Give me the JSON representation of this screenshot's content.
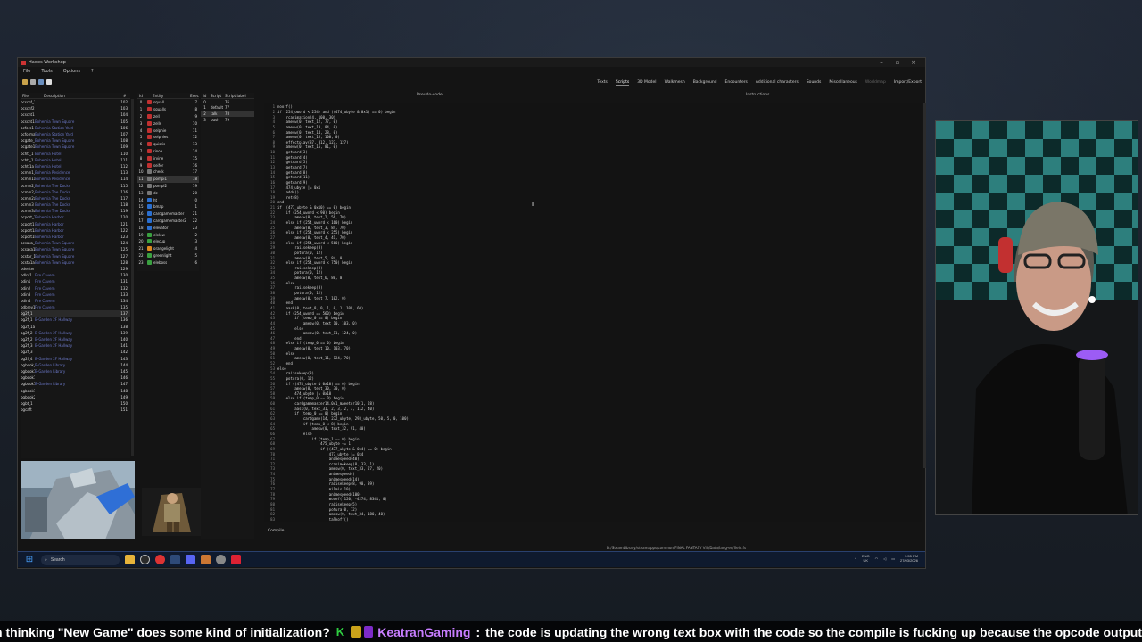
{
  "app": {
    "title": "Hades Workshop",
    "menu": [
      "File",
      "Tools",
      "Options",
      "?"
    ],
    "top_tabs": [
      "Texts",
      "Scripts",
      "3D Model",
      "Walkmesh",
      "Background",
      "Encounters",
      "Additional characters",
      "Sounds",
      "Miscellaneous",
      "Worldmap",
      "Import/Export"
    ],
    "active_tab": "Scripts",
    "file_panel": {
      "headers": [
        "File",
        "Description",
        "#"
      ],
      "rows": [
        {
          "f": "bcscnf_1",
          "d": "",
          "n": "102"
        },
        {
          "f": "bcscnf2",
          "d": "",
          "n": "103"
        },
        {
          "f": "bcscnt15",
          "d": "",
          "n": "104"
        },
        {
          "f": "bcscnt1a",
          "d": "Bohemia Town Square",
          "n": "105"
        },
        {
          "f": "bcfors1",
          "d": "Bohemia Station Yard",
          "n": "106"
        },
        {
          "f": "bcforma1a",
          "d": "Bohemia Station Yard",
          "n": "107"
        },
        {
          "f": "bcgate_1",
          "d": "Bohemia Town Square",
          "n": "108"
        },
        {
          "f": "bcgate1a",
          "d": "Bohemia Town Square",
          "n": "109"
        },
        {
          "f": "bchtl_1",
          "d": "Bohemia Hotel",
          "n": "110"
        },
        {
          "f": "bchtl_1",
          "d": "Bohemia Hotel",
          "n": "111"
        },
        {
          "f": "bchtl1a",
          "d": "Bohemia Hotel",
          "n": "112"
        },
        {
          "f": "bcmin1_1",
          "d": "Bohemia Residence",
          "n": "113"
        },
        {
          "f": "bcmin1a",
          "d": "Bohemia Residence",
          "n": "114"
        },
        {
          "f": "bcmin2_1",
          "d": "Bohemia The Docks",
          "n": "115"
        },
        {
          "f": "bcmin2_1",
          "d": "Bohemia The Docks",
          "n": "116"
        },
        {
          "f": "bcmin2a",
          "d": "Bohemia The Docks",
          "n": "117"
        },
        {
          "f": "bcmin3",
          "d": "Bohemia The Docks",
          "n": "118"
        },
        {
          "f": "bcmin3a",
          "d": "Bohemia The Docks",
          "n": "119"
        },
        {
          "f": "bcport_1",
          "d": "Bohemia Harbor",
          "n": "120"
        },
        {
          "f": "bcport1",
          "d": "Bohemia Harbor",
          "n": "121"
        },
        {
          "f": "bcport1a",
          "d": "Bohemia Harbor",
          "n": "122"
        },
        {
          "f": "bcport1b",
          "d": "Bohemia Harbor",
          "n": "123"
        },
        {
          "f": "bcsaka_1",
          "d": "Bohemia Town Square",
          "n": "124"
        },
        {
          "f": "bcsaka1a",
          "d": "Bohemia Town Square",
          "n": "125"
        },
        {
          "f": "bcstar_1",
          "d": "Bohemia Town Square",
          "n": "127"
        },
        {
          "f": "bcsta1a",
          "d": "Bohemia Town Square",
          "n": "128"
        },
        {
          "f": "bdenter1",
          "d": "",
          "n": "129"
        },
        {
          "f": "bdlnt1",
          "d": "Fire Cavern",
          "n": "130"
        },
        {
          "f": "bdin1",
          "d": "Fire Cavern",
          "n": "131"
        },
        {
          "f": "bdin2",
          "d": "Fire Cavern",
          "n": "132"
        },
        {
          "f": "bdin3",
          "d": "Fire Cavern",
          "n": "133"
        },
        {
          "f": "bdin4",
          "d": "Fire Cavern",
          "n": "134"
        },
        {
          "f": "bdbrev1",
          "d": "Fire Cavern",
          "n": "135"
        },
        {
          "f": "bg2f_1",
          "d": "",
          "n": "137"
        },
        {
          "f": "bg2f_1",
          "d": "B-Garden 2F Hallway",
          "n": "136"
        },
        {
          "f": "bg2f_1a",
          "d": "",
          "n": "138"
        },
        {
          "f": "bg2f_2",
          "d": "B-Garden 2F Hallway",
          "n": "139"
        },
        {
          "f": "bg2f_2",
          "d": "B-Garden 2F Hallway",
          "n": "140"
        },
        {
          "f": "bg2f_3",
          "d": "B-Garden 2F Hallway",
          "n": "141"
        },
        {
          "f": "bg2f_3",
          "d": "",
          "n": "142"
        },
        {
          "f": "bg2f_4",
          "d": "B-Garden 2F Hallway",
          "n": "143"
        },
        {
          "f": "bgbook_1",
          "d": "B-Garden Library",
          "n": "144"
        },
        {
          "f": "bgbook1",
          "d": "B-Garden Library",
          "n": "145"
        },
        {
          "f": "bgbook1a",
          "d": "",
          "n": "146"
        },
        {
          "f": "bgbook1b",
          "d": "B-Garden Library",
          "n": "147"
        },
        {
          "f": "bgbook1c",
          "d": "",
          "n": "148"
        },
        {
          "f": "bgbook2",
          "d": "",
          "n": "149"
        },
        {
          "f": "bgbt_1",
          "d": "",
          "n": "150"
        },
        {
          "f": "bgcaft",
          "d": "",
          "n": "151"
        }
      ]
    },
    "entity_panel": {
      "headers": [
        "Id",
        "Entity",
        "Exec"
      ],
      "rows": [
        {
          "id": "0",
          "name": "squall",
          "n": "7",
          "c": "#c03030"
        },
        {
          "id": "1",
          "name": "squalls",
          "n": "8",
          "c": "#c03030"
        },
        {
          "id": "2",
          "name": "zell",
          "n": "9",
          "c": "#c03030"
        },
        {
          "id": "3",
          "name": "zells",
          "n": "10",
          "c": "#c03030"
        },
        {
          "id": "4",
          "name": "selphie",
          "n": "11",
          "c": "#c03030"
        },
        {
          "id": "5",
          "name": "selphies",
          "n": "12",
          "c": "#c03030"
        },
        {
          "id": "6",
          "name": "quistis",
          "n": "13",
          "c": "#c03030"
        },
        {
          "id": "7",
          "name": "rinoa",
          "n": "14",
          "c": "#c03030"
        },
        {
          "id": "8",
          "name": "irvine",
          "n": "15",
          "c": "#c03030"
        },
        {
          "id": "9",
          "name": "seifer",
          "n": "16",
          "c": "#c03030"
        },
        {
          "id": "10",
          "name": "check",
          "n": "17",
          "c": "#777"
        },
        {
          "id": "11",
          "name": "pompi1",
          "n": "18",
          "c": "#777"
        },
        {
          "id": "12",
          "name": "pompi2",
          "n": "19",
          "c": "#777"
        },
        {
          "id": "13",
          "name": "dc",
          "n": "20",
          "c": "#777"
        },
        {
          "id": "14",
          "name": "ht",
          "n": "0",
          "c": "#2a6fd0"
        },
        {
          "id": "15",
          "name": "bmap",
          "n": "1",
          "c": "#2a6fd0"
        },
        {
          "id": "16",
          "name": "cardgamemaster",
          "n": "21",
          "c": "#2a6fd0"
        },
        {
          "id": "17",
          "name": "cardgamemaster2",
          "n": "22",
          "c": "#2a6fd0"
        },
        {
          "id": "18",
          "name": "elevator",
          "n": "23",
          "c": "#2a6fd0"
        },
        {
          "id": "19",
          "name": "elelow",
          "n": "2",
          "c": "#3aa040"
        },
        {
          "id": "20",
          "name": "elecup",
          "n": "3",
          "c": "#3aa040"
        },
        {
          "id": "21",
          "name": "orangelight",
          "n": "4",
          "c": "#e08a20"
        },
        {
          "id": "22",
          "name": "greenlight",
          "n": "5",
          "c": "#3aa040"
        },
        {
          "id": "23",
          "name": "eleboss",
          "n": "6",
          "c": "#3aa040"
        }
      ],
      "selected": 11
    },
    "script_panel": {
      "headers": [
        "Id",
        "Script",
        "Script label"
      ],
      "rows": [
        {
          "id": "0",
          "name": "",
          "n": "76"
        },
        {
          "id": "1",
          "name": "default",
          "n": "77"
        },
        {
          "id": "2",
          "name": "talk",
          "n": "78"
        },
        {
          "id": "3",
          "name": "push",
          "n": "79"
        }
      ],
      "selected": 2
    },
    "pseudo_code_label": "Pseudo-code",
    "instructions_label": "Instructions",
    "code_lines": [
      "noorf()",
      "if (254_uword < 254) and ((474_ubyte & 0x1) == 0) begin",
      "    rcanimation(4, 100, 30)",
      "    amesw(0, text_12, 77, 0)",
      "    amesw(0, text_13, 84, 0)",
      "    amesw(0, text_14, 28, 0)",
      "    amesw(0, text_15, 100, 0)",
      "    effectplay(87, 812, 127, 127)",
      "    amesw(0, text_16, 81, 0)",
      "    getcard(3)",
      "    getcard(4)",
      "    getcard(5)",
      "    getcard(7)",
      "    getcard(8)",
      "    getcard(11)",
      "    getcard(9)",
      "    474_ubyte |= 0x1",
      "    addd()",
      "    ret(8)",
      "end",
      "if ((477_ubyte & 0x10) == 0) begin",
      "    if (254_uword < 90) begin",
      "        amesw(0, text_2, 56, 70)",
      "    else if (254_uword < 160) begin",
      "        amesw(0, text_3, 84, 70)",
      "    else if (254_uword < 255) begin",
      "        amesw(0, text_4, 41, 70)",
      "    else if (254_uword < 560) begin",
      "        raiisekeep(3)",
      "        potura(0, 12)",
      "        amesw(0, text_5, 84, 0)",
      "    else if (254_uword < 750) begin",
      "        raiisekeep(3)",
      "        potura(0, 12)",
      "        amesw(0, text_6, 80, 0)",
      "    else",
      "        raiisekeep(3)",
      "        potura(0, 12)",
      "        amesw(0, text_7, 102, 0)",
      "    end",
      "    aask(0, text_8, 0, 1, 0, 1, 109, 60)",
      "    if (254_uword == 560) begin",
      "        if (temp_0 == 0) begin",
      "            amesw(0, text_10, 103, 0)",
      "        else",
      "            amesw(0, text_11, 124, 0)",
      "        end",
      "    else if (temp_0 == 0) begin",
      "        amesw(0, text_10, 103, 70)",
      "    else",
      "        amesw(0, text_11, 124, 70)",
      "    end",
      "else",
      "    raiisekeep(3)",
      "    potura(0, 12)",
      "    if ((474_ubyte & 0x10) == 0) begin",
      "        amesw(0, text_30, 30, 0)",
      "        474_ubyte |= 0x10",
      "    else if (temp_0 == 0) begin",
      "        cardgamemaster14.0x1_maeetor10(1, 28)",
      "        aask(0, text_31, 2, 3, 2, 3, 112, 40)",
      "        if (temp_0 == 0) begin",
      "            cardgame(14, 232_ubyte, 293_ubyte, 50, 5, 0, 100)",
      "            if (temp_0 < 8) begin",
      "                amesw(0, text_32, 91, 40)",
      "            else",
      "                if (temp_1 == 0) begin",
      "                    475_ubyte += 1",
      "                    if ((477_ubyte & 0x4) == 0) begin",
      "                        477_ubyte |= 0x4",
      "                        animespeed(40)",
      "                        rcanimekeep(8, 33, 1)",
      "                        amesw(0, text_33, 27, 20)",
      "                        animespeed()",
      "                        animespeed(14)",
      "                        raiisekeep(8, 90, 39)",
      "                        milmis(10)",
      "                        animespeed(100)",
      "                        movef(-120, -4274, 8341, 0)",
      "                        raiisekeep(5)",
      "                        potura(0, 12)",
      "                        amesw(0, text_34, 180, 40)",
      "                        talkoff()",
      "                        movef(-116, -5602, 8341, 0)"
    ],
    "compile_label": "Compile",
    "status_path": "D:/SteamLibrary/steamapps/common/FINAL FANTASY VIII/Data/lang-en/field.fs"
  },
  "taskbar": {
    "search_placeholder": "Search",
    "lang": "ENG",
    "region": "UK",
    "time": "3:55 PM",
    "date": "27/03/2026"
  },
  "ticker": {
    "prev_text": "n thinking \"New Game\" does some kind of initialization?",
    "emote_text": "K",
    "username": "KeatranGaming",
    "separator": ":",
    "message": "the code is updating the wrong text box with the code so the compile is fucking up because the opcode output"
  }
}
